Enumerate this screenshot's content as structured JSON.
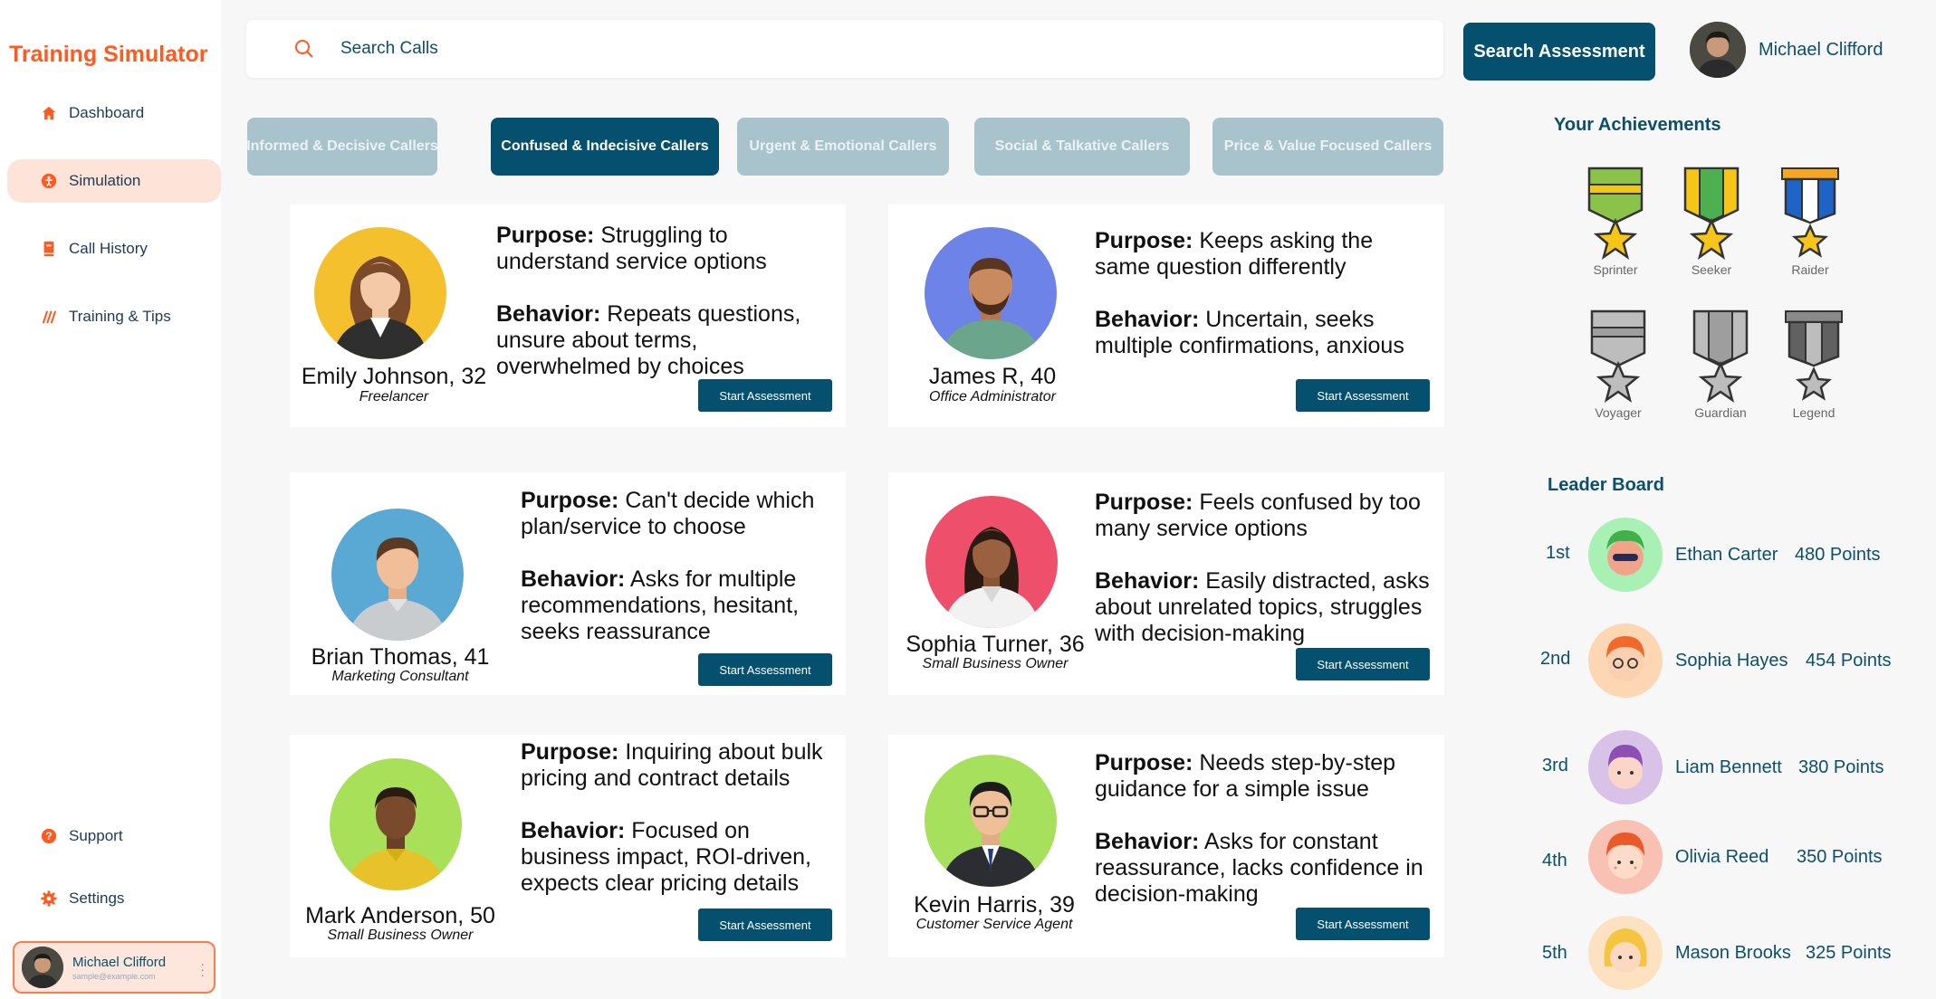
{
  "app": {
    "title": "Training Simulator"
  },
  "sidebar": {
    "items": [
      {
        "label": "Dashboard",
        "icon": "home-icon"
      },
      {
        "label": "Simulation",
        "icon": "simulation-icon",
        "active": true
      },
      {
        "label": "Call History",
        "icon": "book-icon"
      },
      {
        "label": "Training & Tips",
        "icon": "tips-icon"
      }
    ],
    "bottom_items": [
      {
        "label": "Support",
        "icon": "help-icon"
      },
      {
        "label": "Settings",
        "icon": "gear-icon"
      }
    ],
    "user": {
      "name": "Michael Clifford",
      "email": "sample@example.com"
    }
  },
  "search": {
    "placeholder": "Search Calls",
    "button_label": "Search Assessment"
  },
  "header_user": {
    "name": "Michael Clifford"
  },
  "tabs": [
    {
      "label": "Informed & Decisive Callers",
      "active": false
    },
    {
      "label": "Confused & Indecisive Callers",
      "active": true
    },
    {
      "label": "Urgent & Emotional Callers",
      "active": false
    },
    {
      "label": "Social & Talkative Callers",
      "active": false
    },
    {
      "label": "Price & Value Focused Callers",
      "active": false
    }
  ],
  "cards": [
    {
      "name": "Emily Johnson, 32",
      "role": "Freelancer",
      "purpose_label": "Purpose:",
      "purpose": "Struggling to understand service options",
      "behavior_label": "Behavior:",
      "behavior": "Repeats questions, unsure about terms, overwhelmed by choices",
      "button": "Start Assessment"
    },
    {
      "name": "James R, 40",
      "role": "Office Administrator",
      "purpose_label": "Purpose:",
      "purpose": "Keeps asking the same question differently",
      "behavior_label": "Behavior:",
      "behavior": "Uncertain, seeks multiple confirmations, anxious",
      "button": "Start Assessment"
    },
    {
      "name": "Brian Thomas, 41",
      "role": "Marketing Consultant",
      "purpose_label": "Purpose:",
      "purpose": "Can't decide which plan/service to choose",
      "behavior_label": "Behavior:",
      "behavior": "Asks for multiple recommendations, hesitant, seeks reassurance",
      "button": "Start Assessment"
    },
    {
      "name": "Sophia Turner, 36",
      "role": "Small Business Owner",
      "purpose_label": "Purpose:",
      "purpose": "Feels confused by too many service options",
      "behavior_label": "Behavior:",
      "behavior": "Easily distracted, asks about unrelated topics, struggles with decision-making",
      "button": "Start Assessment"
    },
    {
      "name": "Mark Anderson, 50",
      "role": "Small Business Owner",
      "purpose_label": "Purpose:",
      "purpose": "Inquiring about bulk pricing and contract details",
      "behavior_label": "Behavior:",
      "behavior": "Focused on business impact, ROI-driven, expects clear pricing details",
      "button": "Start Assessment"
    },
    {
      "name": "Kevin Harris, 39",
      "role": "Customer Service Agent",
      "purpose_label": "Purpose:",
      "purpose": "Needs step-by-step guidance for a simple issue",
      "behavior_label": "Behavior:",
      "behavior": "Asks for constant reassurance, lacks confidence in decision-making",
      "button": "Start Assessment"
    }
  ],
  "achievements": {
    "title": "Your Achievements",
    "badges": [
      {
        "label": "Sprinter",
        "colors": [
          "#8bc34a",
          "#f5c518"
        ]
      },
      {
        "label": "Seeker",
        "colors": [
          "#4caf50",
          "#f5c518"
        ]
      },
      {
        "label": "Raider",
        "colors": [
          "#1e63c6",
          "#f5c518"
        ]
      },
      {
        "label": "Voyager",
        "colors": [
          "#9e9e9e",
          "#bdbdbd"
        ]
      },
      {
        "label": "Guardian",
        "colors": [
          "#9e9e9e",
          "#bdbdbd"
        ]
      },
      {
        "label": "Legend",
        "colors": [
          "#616161",
          "#bdbdbd"
        ]
      }
    ]
  },
  "leaderboard": {
    "title": "Leader Board",
    "rows": [
      {
        "rank": "1st",
        "name": "Ethan Carter",
        "points": "480 Points",
        "bg": "#a8f0b4"
      },
      {
        "rank": "2nd",
        "name": "Sophia Hayes",
        "points": "454 Points",
        "bg": "#fdd7b4"
      },
      {
        "rank": "3rd",
        "name": "Liam Bennett",
        "points": "380 Points",
        "bg": "#d9c2e8"
      },
      {
        "rank": "4th",
        "name": "Olivia Reed",
        "points": "350 Points",
        "bg": "#f9c1b4"
      },
      {
        "rank": "5th",
        "name": "Mason Brooks",
        "points": "325 Points",
        "bg": "#fde2c2"
      }
    ]
  },
  "colors": {
    "accent": "#ff5a1f",
    "primary": "#05506e",
    "tab_inactive": "#a9c3cd"
  }
}
